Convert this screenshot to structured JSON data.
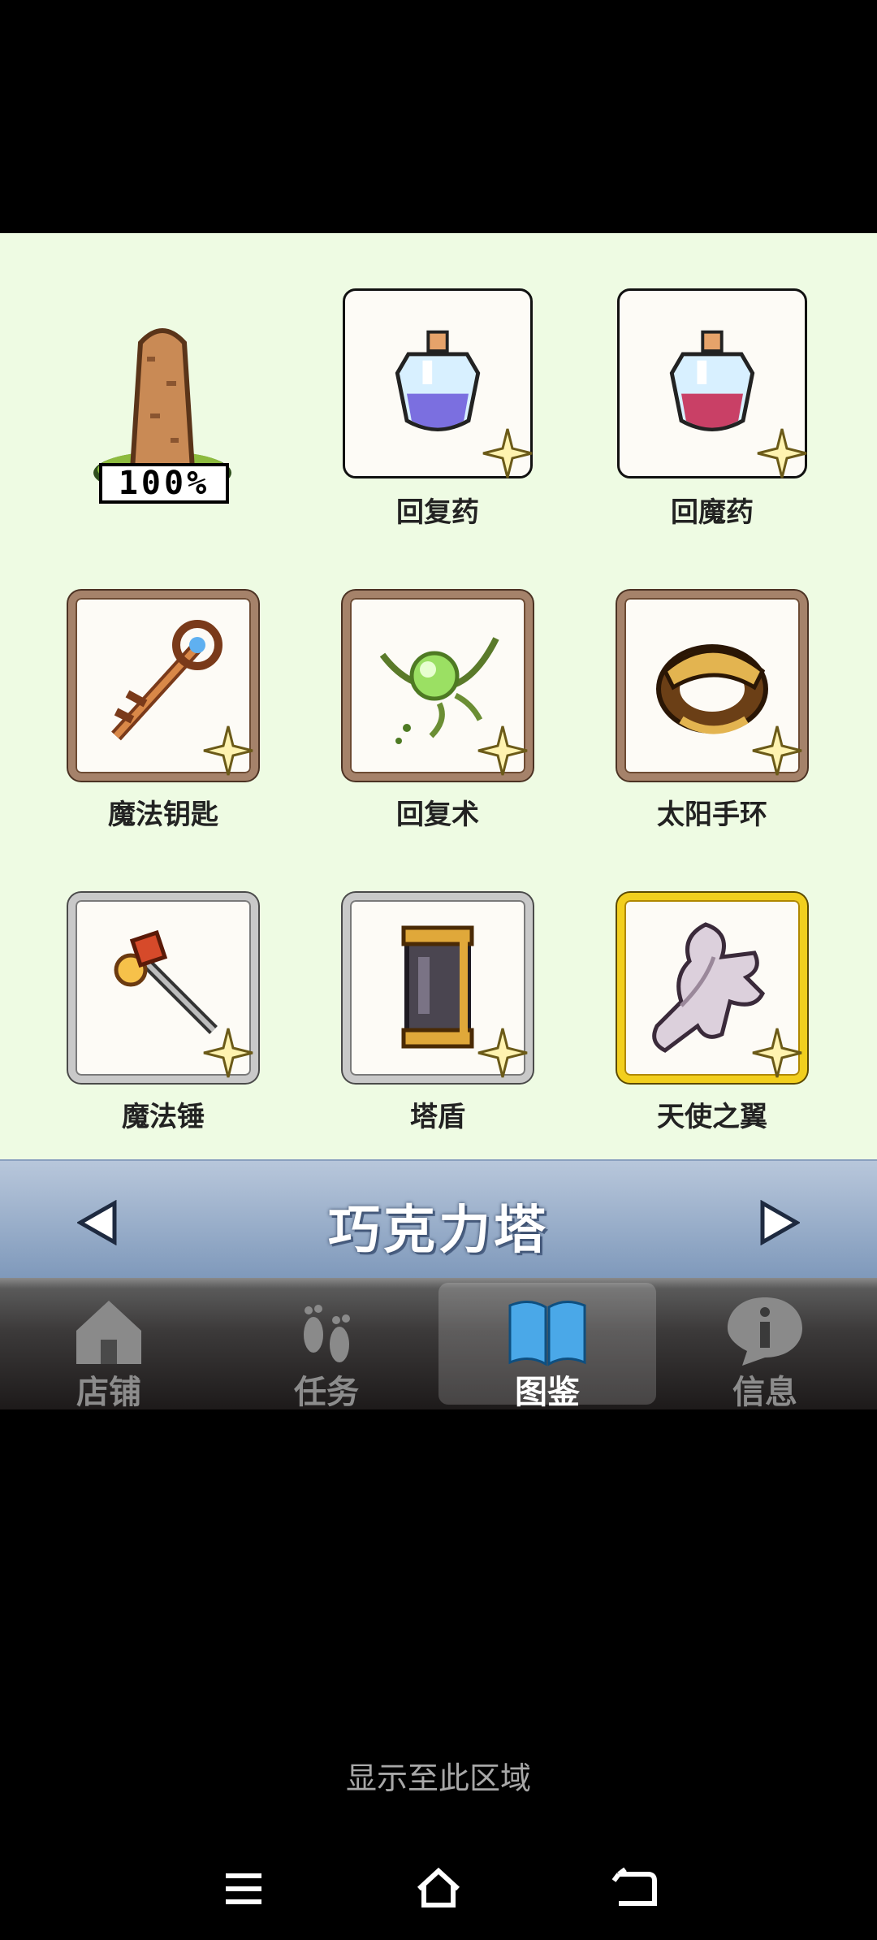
{
  "progress": {
    "text": "100%",
    "value_percent": 100
  },
  "items": [
    {
      "name": "回复药",
      "frame": "black",
      "icon": "blue-potion-icon"
    },
    {
      "name": "回魔药",
      "frame": "black",
      "icon": "red-potion-icon"
    },
    {
      "name": "魔法钥匙",
      "frame": "brown",
      "icon": "magic-key-icon"
    },
    {
      "name": "回复术",
      "frame": "brown",
      "icon": "heal-spell-icon"
    },
    {
      "name": "太阳手环",
      "frame": "brown",
      "icon": "sun-bracelet-icon"
    },
    {
      "name": "魔法锤",
      "frame": "silver",
      "icon": "magic-hammer-icon"
    },
    {
      "name": "塔盾",
      "frame": "silver",
      "icon": "tower-shield-icon"
    },
    {
      "name": "天使之翼",
      "frame": "gold",
      "icon": "angel-wing-icon"
    }
  ],
  "header": {
    "title": "巧克力塔"
  },
  "tabs": [
    {
      "label": "店铺",
      "icon": "home-icon",
      "active": false
    },
    {
      "label": "任务",
      "icon": "footprints-icon",
      "active": false
    },
    {
      "label": "图鉴",
      "icon": "book-icon",
      "active": true
    },
    {
      "label": "信息",
      "icon": "info-bubble-icon",
      "active": false
    }
  ],
  "footer": {
    "hint": "显示至此区域"
  },
  "colors": {
    "background": "#eefbe3",
    "titlebar": "#8ea6c5",
    "gold_frame": "#f2cf1e",
    "brown_frame": "#a5826a"
  }
}
